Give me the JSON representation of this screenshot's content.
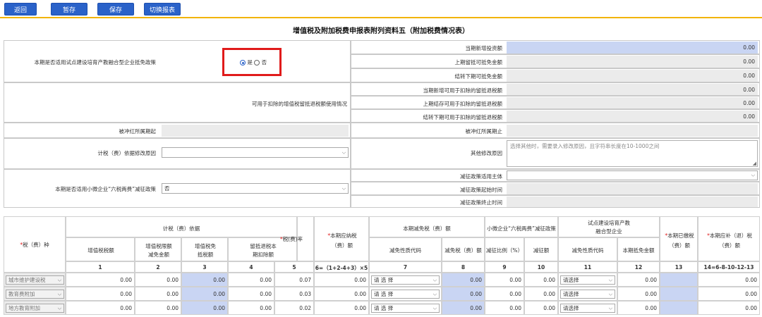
{
  "toolbar": {
    "back": "返回",
    "draft": "暂存",
    "save": "保存",
    "switch": "切换报表"
  },
  "title": "增值税及附加税费申报表附列资料五（附加税费情况表）",
  "section1": {
    "question": "本期是否适用试点建设培育产教融合型企业抵免政策",
    "yes": "是",
    "no": "否",
    "rows": [
      {
        "label": "当期新增投资额",
        "value": "0.00"
      },
      {
        "label": "上期留抵可抵免金额",
        "value": "0.00"
      },
      {
        "label": "结转下期可抵免金额",
        "value": "0.00"
      }
    ]
  },
  "section2": {
    "label": "可用于扣除的增值税留抵退税额使用情况",
    "rows": [
      {
        "label": "当期新增可用于扣除的留抵退税额",
        "value": "0.00"
      },
      {
        "label": "上期结存可用于扣除的留抵退税额",
        "value": "0.00"
      },
      {
        "label": "结转下期可用于扣除的留抵退税额",
        "value": "0.00"
      }
    ]
  },
  "section3": {
    "start_label": "被冲红所属期起",
    "end_label": "被冲红所属期止",
    "reason_label": "计税（费）依据修改原因",
    "other_reason_label": "其他修改原因",
    "other_reason_placeholder": "选择其他时，需要录入修改原因，且字符串长度在10-1000之间"
  },
  "section4": {
    "question": "本期是否适用小微企业“六税两费”减征政策",
    "answer": "否",
    "subject_label": "减征政策适用主体",
    "start_label": "减征政策起始时间",
    "end_label": "减征政策终止时间"
  },
  "table": {
    "col_tax": "税（费）种",
    "col_basis": "计税（费）依据",
    "col_vat": "增值税税额",
    "col_vat_exempt": "增值税限额减免金额",
    "col_vat_free": "增值税免抵税额",
    "col_refund": "留抵退税本期扣除额",
    "col_rate": "税(费)率",
    "col_payable": "本期应纳税（费）额",
    "col_reduce": "本期减免税（费）额",
    "col_reduce_code": "减免性质代码",
    "col_reduce_amount": "减免税（费）额",
    "col_small": "小微企业“六税两费”减征政策",
    "col_small_ratio": "减征比例（%）",
    "col_small_amount": "减征额",
    "col_pilot": "试点建设培育产教融合型企业",
    "col_pilot_code": "减免性质代码",
    "col_pilot_amount": "本期抵免金额",
    "col_paid": "本期已缴税（费）额",
    "col_due": "本期应补（退）税（费）额",
    "nums": [
      "1",
      "2",
      "3",
      "4",
      "5",
      "6=（1+2-4+3）×5",
      "7",
      "8",
      "9",
      "10",
      "11",
      "12",
      "13",
      "14=6-8-10-12-13"
    ],
    "rows": [
      {
        "name": "城市维护建设税",
        "v1": "0.00",
        "v2": "0.00",
        "v3": "0.00",
        "v4": "0.00",
        "rate": "0.07",
        "payable": "0.00",
        "code": "请 选 择",
        "v8": "0.00",
        "v9": "0.00",
        "v10": "0.00",
        "pcode": "请选择",
        "v12": "0.00",
        "v13": "",
        "v14": "0.00"
      },
      {
        "name": "教育费附加",
        "v1": "0.00",
        "v2": "0.00",
        "v3": "0.00",
        "v4": "0.00",
        "rate": "0.03",
        "payable": "0.00",
        "code": "请 选 择",
        "v8": "0.00",
        "v9": "0.00",
        "v10": "0.00",
        "pcode": "请选择",
        "v12": "0.00",
        "v13": "",
        "v14": "0.00"
      },
      {
        "name": "地方教育附加",
        "v1": "0.00",
        "v2": "0.00",
        "v3": "0.00",
        "v4": "0.00",
        "rate": "0.02",
        "payable": "0.00",
        "code": "请 选 择",
        "v8": "0.00",
        "v9": "0.00",
        "v10": "0.00",
        "pcode": "请选择",
        "v12": "0.00",
        "v13": "",
        "v14": "0.00"
      }
    ]
  },
  "colors": {
    "primary": "#2a62c9",
    "accent": "#f2b400",
    "input_blue": "#c9d5f3",
    "readonly": "#ebebeb",
    "highlight": "#e01b1b"
  }
}
